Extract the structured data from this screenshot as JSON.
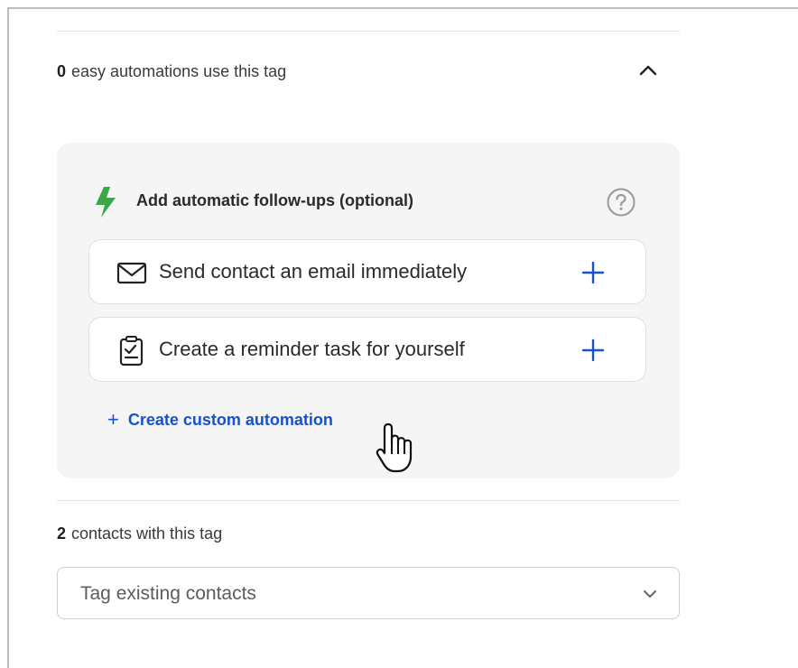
{
  "automations_section": {
    "count": "0",
    "label": "easy automations use this tag"
  },
  "followups_panel": {
    "title": "Add automatic follow-ups (optional)",
    "actions": [
      {
        "label": "Send contact an email immediately",
        "icon": "envelope-icon"
      },
      {
        "label": "Create a reminder task for yourself",
        "icon": "clipboard-task-icon"
      }
    ],
    "custom_link": {
      "plus": "+",
      "label": "Create custom automation"
    }
  },
  "contacts_section": {
    "count": "2",
    "label": "contacts with this tag",
    "select_placeholder": "Tag existing contacts"
  },
  "colors": {
    "accent_blue": "#1452d1",
    "bolt_green": "#3aa843",
    "panel_bg": "#f5f5f5"
  }
}
